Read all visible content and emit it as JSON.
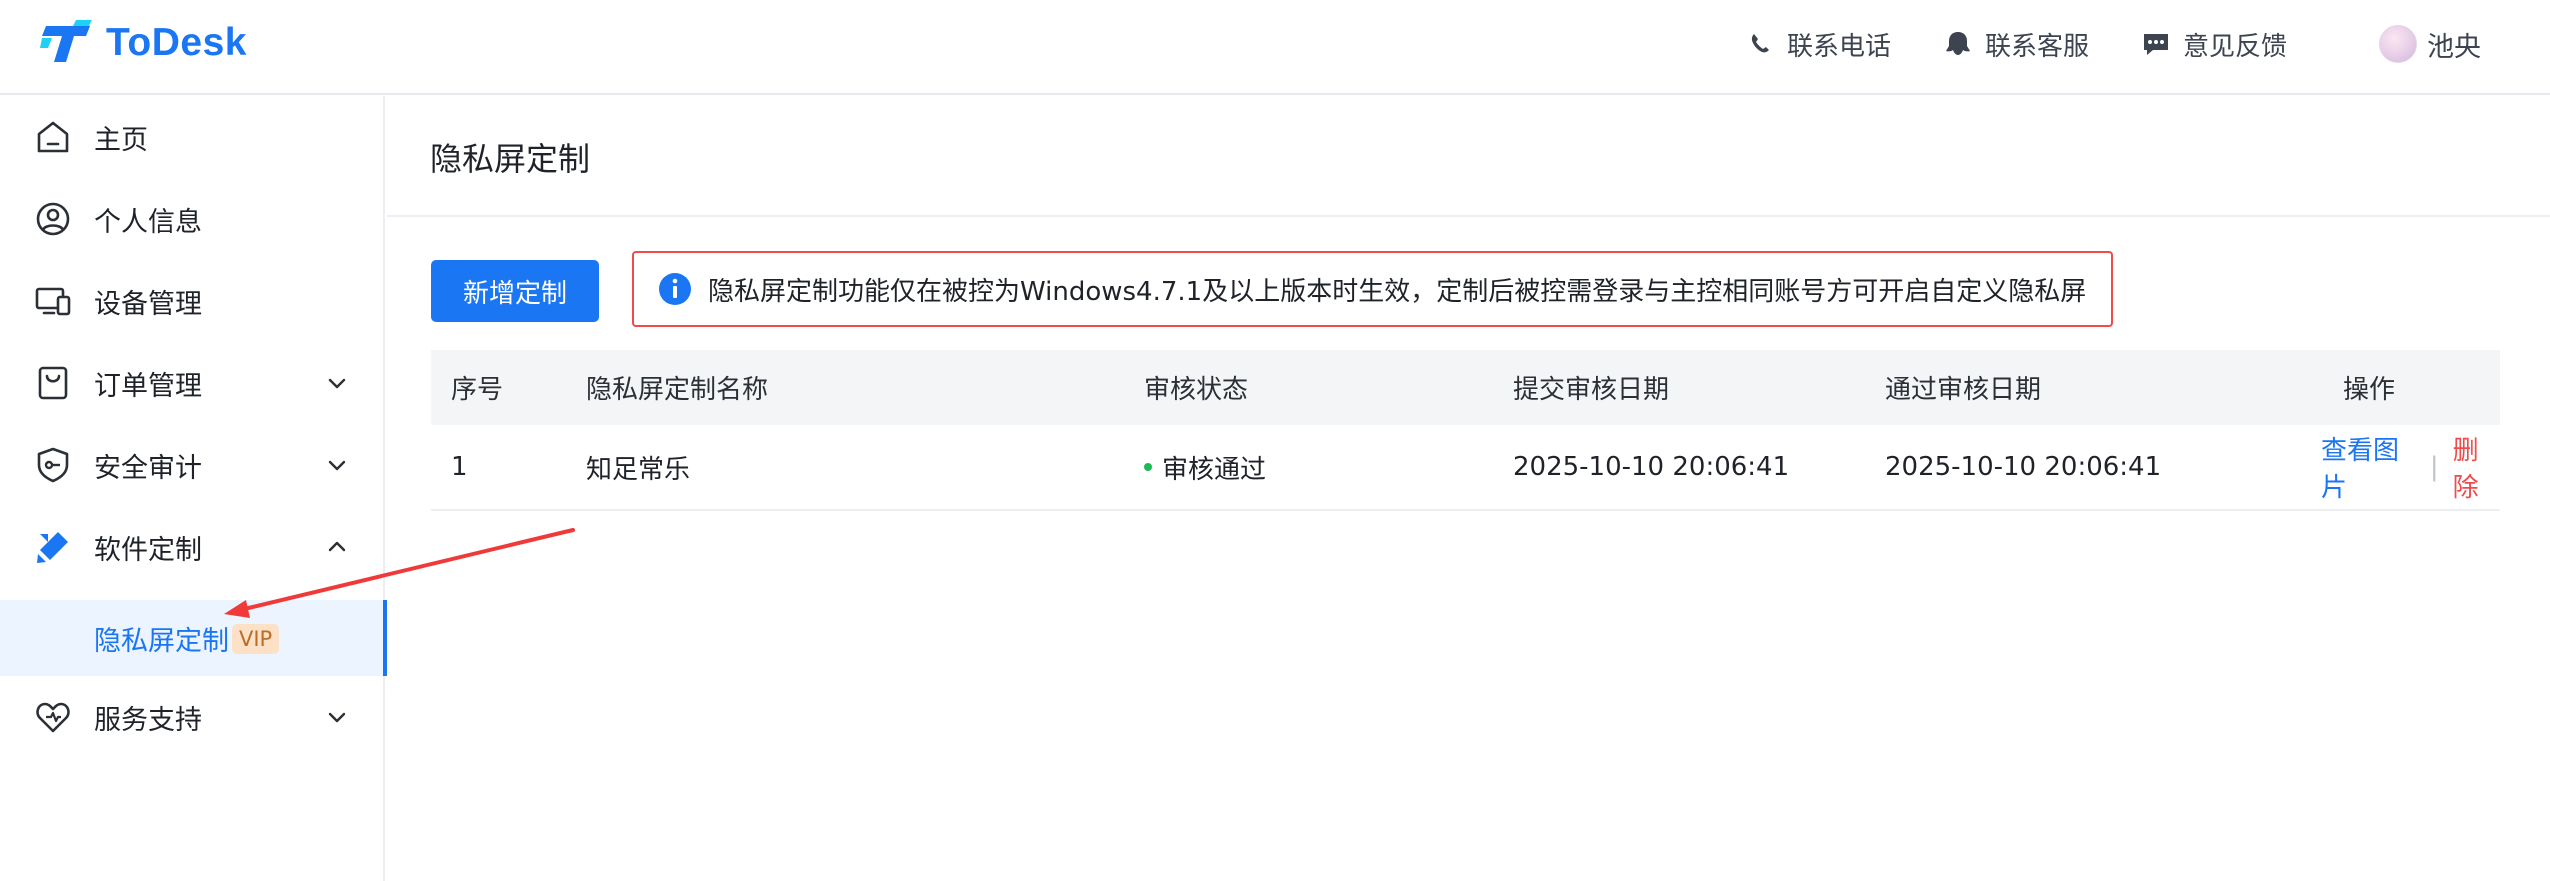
{
  "brand": {
    "name": "ToDesk",
    "accent": "#1a76f2"
  },
  "header": {
    "links": [
      {
        "label": "联系电话",
        "icon": "phone-icon"
      },
      {
        "label": "联系客服",
        "icon": "support-icon"
      },
      {
        "label": "意见反馈",
        "icon": "feedback-icon"
      }
    ],
    "user": {
      "name": "池央"
    }
  },
  "sidebar": {
    "items": [
      {
        "label": "主页",
        "icon": "home-icon"
      },
      {
        "label": "个人信息",
        "icon": "user-icon"
      },
      {
        "label": "设备管理",
        "icon": "device-icon"
      },
      {
        "label": "订单管理",
        "icon": "order-icon",
        "chevron": "down"
      },
      {
        "label": "安全审计",
        "icon": "shield-icon",
        "chevron": "down"
      },
      {
        "label": "软件定制",
        "icon": "customize-icon",
        "chevron": "up"
      },
      {
        "label": "服务支持",
        "icon": "support-heart-icon",
        "chevron": "down"
      }
    ],
    "sub_item": {
      "label": "隐私屏定制",
      "badge": "VIP"
    }
  },
  "main": {
    "title": "隐私屏定制",
    "add_button": "新增定制",
    "notice": "隐私屏定制功能仅在被控为Windows4.7.1及以上版本时生效，定制后被控需登录与主控相同账号方可开启自定义隐私屏",
    "table": {
      "columns": [
        "序号",
        "隐私屏定制名称",
        "审核状态",
        "提交审核日期",
        "通过审核日期",
        "操作"
      ],
      "rows": [
        {
          "index": "1",
          "name": "知足常乐",
          "status": "审核通过",
          "submitted": "2025-10-10 20:06:41",
          "approved": "2025-10-10 20:06:41",
          "actions": {
            "view": "查看图片",
            "separator": "|",
            "delete": "删除"
          }
        }
      ]
    }
  },
  "colors": {
    "primary": "#1a76f2",
    "danger": "#f04a4a",
    "success": "#1db954",
    "vip_bg": "#fde1c6"
  }
}
